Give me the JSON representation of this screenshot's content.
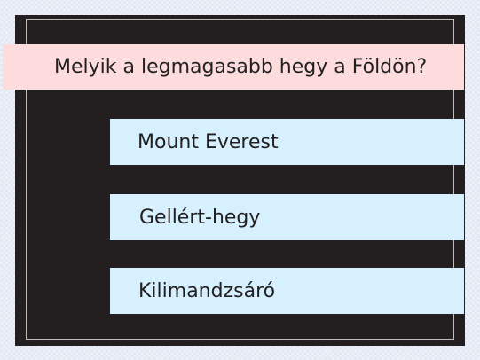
{
  "quiz": {
    "question": "Melyik a legmagasabb hegy a Földön?",
    "answers": [
      {
        "label": "Mount Everest"
      },
      {
        "label": "Gellért-hegy"
      },
      {
        "label": "Kilimandzsáró"
      }
    ]
  },
  "colors": {
    "board": "#231f20",
    "question_bg": "#fcdcdc",
    "answer_bg": "#d6f0fe",
    "text": "#231f20"
  }
}
